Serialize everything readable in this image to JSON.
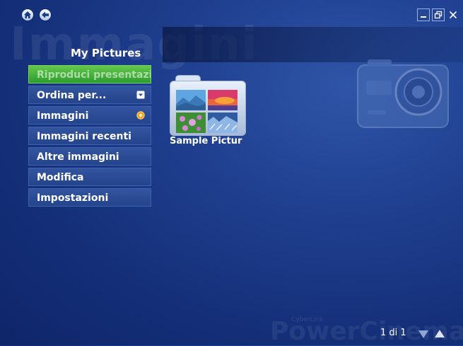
{
  "app": {
    "watermark": "Immagini",
    "brand_small": "CyberLink",
    "brand": "PowerCinema"
  },
  "header": {
    "title": "My Pictures",
    "home_icon": "home-icon",
    "back_icon": "back-arrow-icon"
  },
  "window_controls": [
    "minimize-icon",
    "restore-icon",
    "close-icon"
  ],
  "sidebar": {
    "items": [
      {
        "label": "Riproduci presentazione",
        "active": true
      },
      {
        "label": "Ordina per...",
        "marker": "dropdown-arrow-icon"
      },
      {
        "label": "Immagini",
        "marker": "radio-selected-icon"
      },
      {
        "label": "Immagini recenti"
      },
      {
        "label": "Altre immagini"
      },
      {
        "label": "Modifica"
      },
      {
        "label": "Impostazioni"
      }
    ]
  },
  "content": {
    "folders": [
      {
        "label": "Sample Pictur",
        "icon": "photo-folder-icon"
      }
    ]
  },
  "footer": {
    "pagination": "1 di 1",
    "page_down_icon": "page-down-icon",
    "page_up_icon": "page-up-icon"
  },
  "colors": {
    "background": "#1f3f8f",
    "menu_item": "#2b4c97",
    "active_item": "#4fb53d"
  }
}
